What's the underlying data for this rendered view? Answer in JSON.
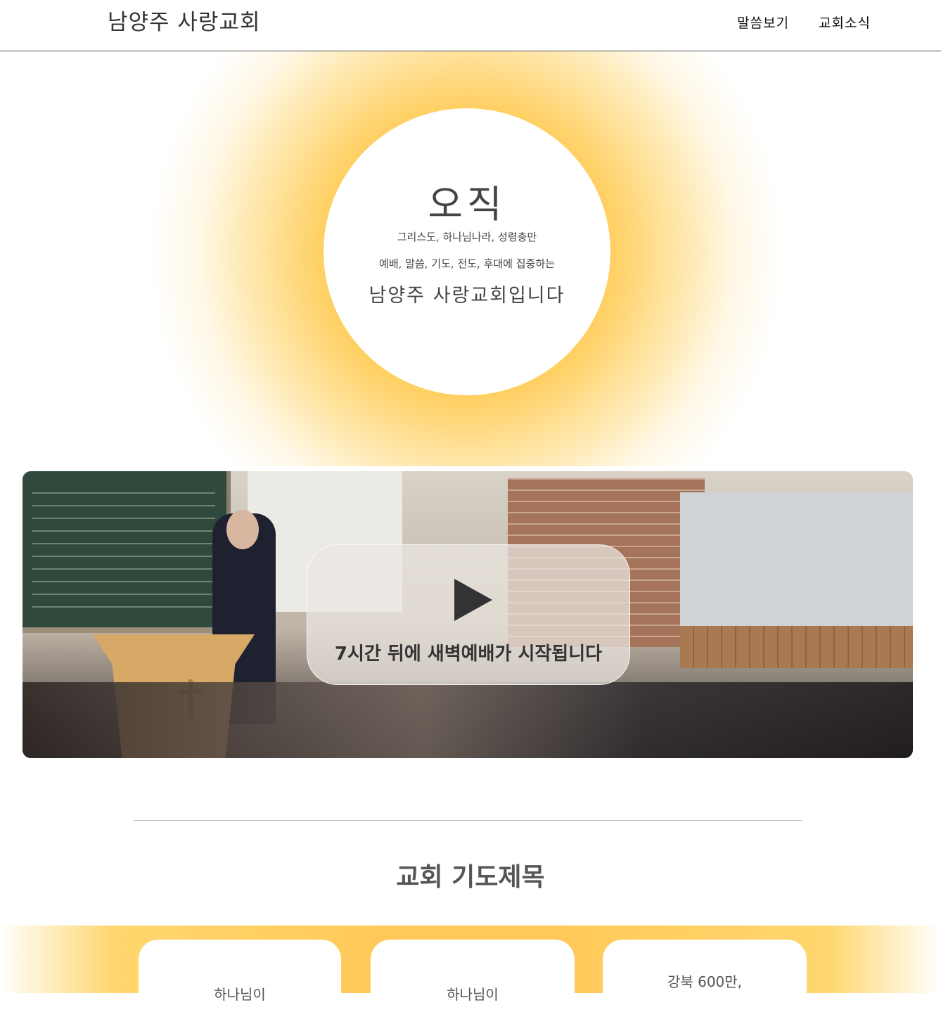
{
  "header": {
    "site_title": "남양주 사랑교회",
    "nav": [
      "말씀보기",
      "교회소식"
    ]
  },
  "hero": {
    "main": "오직",
    "line1": "그리스도, 하나님나라, 성령충만",
    "line2": "예배, 말씀, 기도, 전도, 후대에 집중하는",
    "line3": "남양주 사랑교회입니다"
  },
  "video": {
    "overlay_text": "7시간 뒤에 새벽예배가 시작됩니다",
    "play_icon": "play-icon"
  },
  "prayer": {
    "title": "교회 기도제목",
    "cards": [
      "하나님이",
      "하나님이",
      "강북 600만,"
    ]
  },
  "colors": {
    "accent": "#ffc33d",
    "text": "#333333"
  }
}
